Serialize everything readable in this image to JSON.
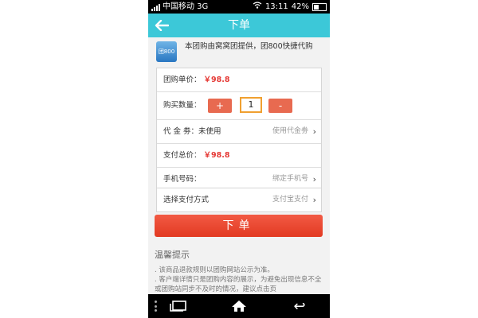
{
  "status_bar": {
    "carrier": "中国移动 3G",
    "time": "13:11",
    "battery": "42%"
  },
  "header": {
    "title": "下单"
  },
  "notice": {
    "logo_text": "团800",
    "text": "本团购由窝窝团提供，团800快捷代购"
  },
  "form": {
    "unit_price_label": "团购单价：",
    "unit_price": "￥98.8",
    "quantity_label": "购买数量：",
    "plus_label": "+",
    "minus_label": "-",
    "quantity_value": "1",
    "voucher_label": "代 金 劵：未使用",
    "voucher_hint": "使用代金劵",
    "total_label": "支付总价：",
    "total_price": "￥98.8",
    "phone_label": "手机号码：",
    "phone_hint": "绑定手机号",
    "payment_label": "选择支付方式",
    "payment_hint": "支付宝支付",
    "arrow": "›"
  },
  "submit": {
    "label": "下单"
  },
  "tips": {
    "title": "温馨提示",
    "line1": ". 该商品退款规则以团购网站公示为准。",
    "line2": ". 客户端详情只是团购内容的展示，为避免出现信息不全或团购站同步不及时的情况，建议点击页"
  },
  "nav": {
    "back_glyph": "↩"
  }
}
